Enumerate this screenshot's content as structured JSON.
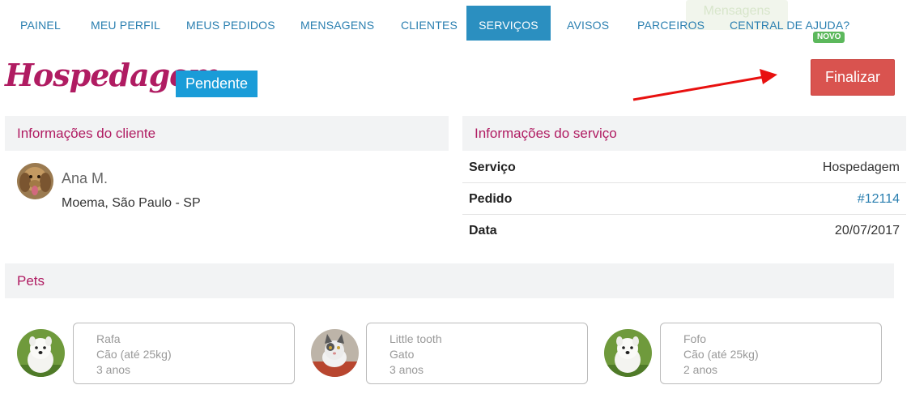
{
  "nav": {
    "items": [
      "PAINEL",
      "MEU PERFIL",
      "MEUS PEDIDOS",
      "MENSAGENS",
      "CLIENTES",
      "SERVIÇOS",
      "AVISOS",
      "PARCEIROS",
      "CENTRAL DE AJUDA?"
    ],
    "active": "SERVIÇOS",
    "ghost_label": "Mensagens",
    "new_badge": "NOVO"
  },
  "header": {
    "title": "Hospedagem-",
    "status": "Pendente",
    "finalize_label": "Finalizar"
  },
  "client": {
    "heading": "Informações do cliente",
    "name": "Ana M.",
    "location": "Moema, São Paulo - SP"
  },
  "service": {
    "heading": "Informações do serviço",
    "rows": [
      {
        "label": "Serviço",
        "value": "Hospedagem"
      },
      {
        "label": "Pedido",
        "value": "#12114"
      },
      {
        "label": "Data",
        "value": "20/07/2017"
      }
    ]
  },
  "pets": {
    "heading": "Pets",
    "items": [
      {
        "name": "Rafa",
        "type": "Cão (até 25kg)",
        "age": "3 anos"
      },
      {
        "name": "Little tooth",
        "type": "Gato",
        "age": "3 anos"
      },
      {
        "name": "Fofo",
        "type": "Cão (até 25kg)",
        "age": "2 anos"
      }
    ]
  },
  "colors": {
    "accent": "#b01c62",
    "nav_active": "#2b8fc0",
    "status": "#1a9cd8",
    "danger": "#d9534f",
    "badge_new": "#5cb85c"
  }
}
